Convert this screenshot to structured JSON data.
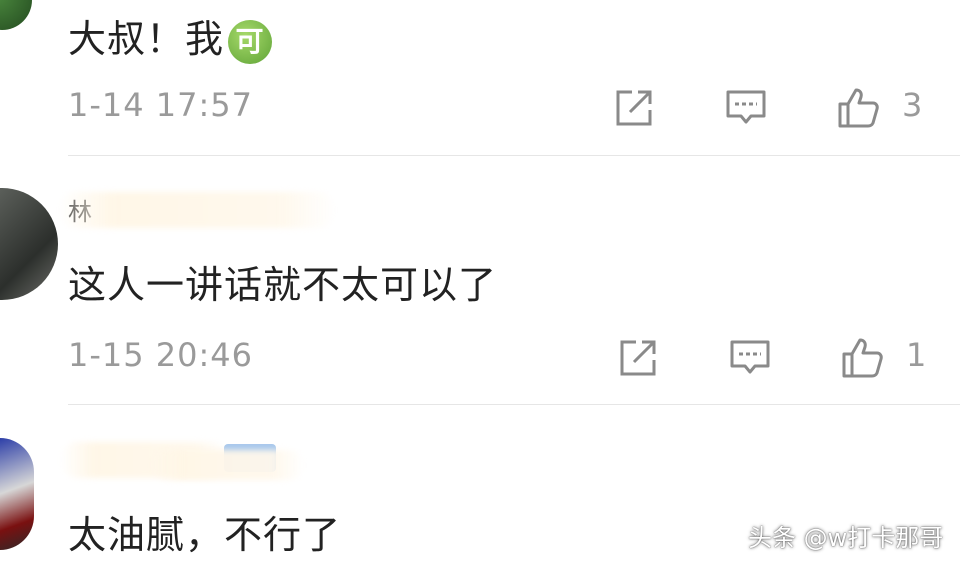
{
  "comments": [
    {
      "username": "",
      "text": "大叔！我",
      "emoji": "可",
      "timestamp": "1-14 17:57",
      "like_count": "3"
    },
    {
      "username": "林",
      "text": "这人一讲话就不太可以了",
      "timestamp": "1-15 20:46",
      "like_count": "1"
    },
    {
      "username": "",
      "text": "太油腻，不行了",
      "has_vip_badge": true
    }
  ],
  "icons": {
    "share": "share-icon",
    "reply": "reply-icon",
    "like": "thumbs-up-icon"
  },
  "colors": {
    "meta_text": "#9a9a9a",
    "comment_text": "#222222",
    "divider": "#e6e6e6",
    "emoji_green": "#6fb23c",
    "vip_blue": "#9fc2ea"
  },
  "watermark": "头条 @w打卡那哥"
}
